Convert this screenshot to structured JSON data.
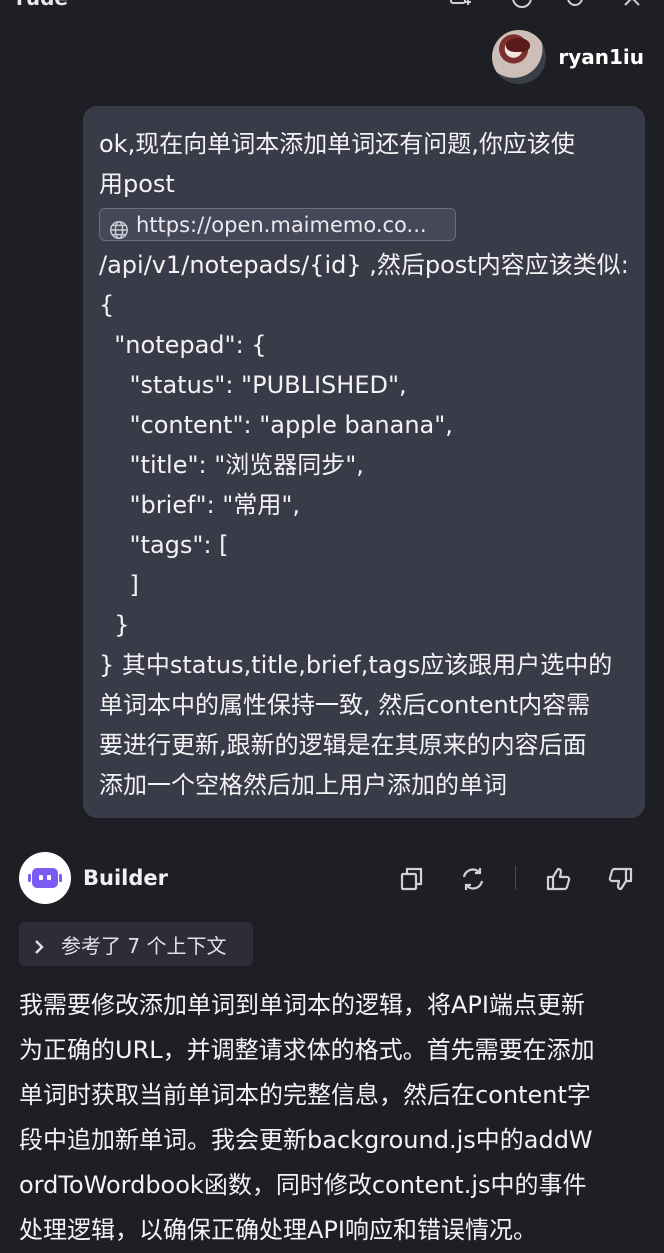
{
  "topbar": {
    "title": "rude"
  },
  "user": {
    "name": "ryan1iu"
  },
  "message": {
    "line1": "ok,现在向单词本添加单词还有问题,你应该使",
    "line2": "用post",
    "link": "https://open.maimemo.co...",
    "line3": "/api/v1/notepads/{id} ,然后post内容应该类似:",
    "line4": "{",
    "line5": "  \"notepad\": {",
    "line6": "    \"status\": \"PUBLISHED\",",
    "line7": "    \"content\": \"apple banana\",",
    "line8": "    \"title\": \"浏览器同步\",",
    "line9": "    \"brief\": \"常用\",",
    "line10": "    \"tags\": [",
    "line11": "    ]",
    "line12": "  }",
    "line13": "} 其中status,title,brief,tags应该跟用户选中的",
    "line14": "单词本中的属性保持一致, 然后content内容需",
    "line15": "要进行更新,跟新的逻辑是在其原来的内容后面",
    "line16": "添加一个空格然后加上用户添加的单词"
  },
  "assistant": {
    "name": "Builder",
    "context_label": "参考了 7 个上下文",
    "answer_lines": [
      "我需要修改添加单词到单词本的逻辑，将API端点更新",
      "为正确的URL，并调整请求体的格式。首先需要在添加",
      "单词时获取当前单词本的完整信息，然后在content字",
      "段中追加新单词。我会更新background.js中的addW",
      "ordToWordbook函数，同时修改content.js中的事件",
      "处理逻辑，以确保正确处理API响应和错误情况。"
    ]
  },
  "icons": {
    "copy": "copy-icon",
    "regenerate": "refresh-icon",
    "like": "thumbs-up-icon",
    "dislike": "thumbs-down-icon",
    "link": "globe-icon",
    "context": "chevron-right-icon"
  },
  "colors": {
    "background": "#1e1f25",
    "bubble": "#3a3b48",
    "chip": "#2c2d36",
    "bot_face": "#7c5bf3"
  }
}
